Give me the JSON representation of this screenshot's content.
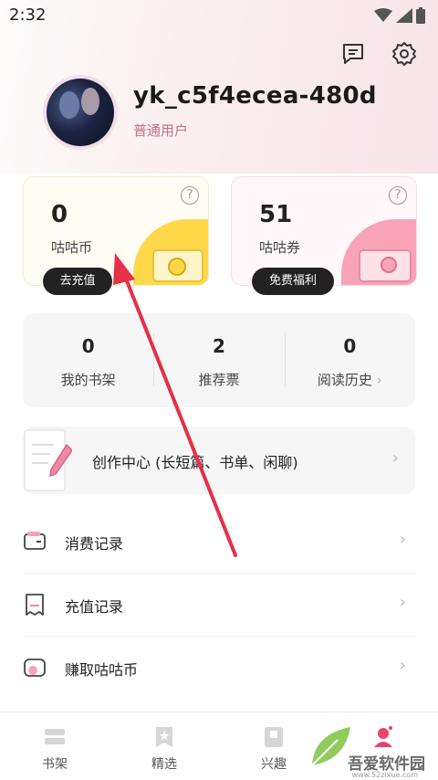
{
  "status_bar": {
    "time": "2:32"
  },
  "profile": {
    "username": "yk_c5f4ecea-480d",
    "user_type": "普通用户"
  },
  "wallet_cards": [
    {
      "value": "0",
      "label": "咕咕币",
      "button": "去充值",
      "help": "?"
    },
    {
      "value": "51",
      "label": "咕咕券",
      "button": "免费福利",
      "help": "?"
    }
  ],
  "stats": [
    {
      "value": "0",
      "label": "我的书架"
    },
    {
      "value": "2",
      "label": "推荐票"
    },
    {
      "value": "0",
      "label": "阅读历史"
    }
  ],
  "create_center": {
    "label": "创作中心 (长短篇、书单、闲聊)"
  },
  "menu": [
    {
      "label": "消费记录",
      "icon": "wallet-icon"
    },
    {
      "label": "充值记录",
      "icon": "receipt-icon"
    },
    {
      "label": "赚取咕咕币",
      "icon": "coin-icon"
    }
  ],
  "tabs": [
    {
      "label": "书架"
    },
    {
      "label": "精选"
    },
    {
      "label": "兴趣"
    }
  ],
  "watermark": {
    "text": "吾爱软件园",
    "url": "www.52zixue.com"
  },
  "colors": {
    "accent": "#e8436a",
    "yellow": "#ffd84a",
    "pink": "#f8a3b8",
    "dark_button": "#222222",
    "arrow": "#e53048"
  }
}
